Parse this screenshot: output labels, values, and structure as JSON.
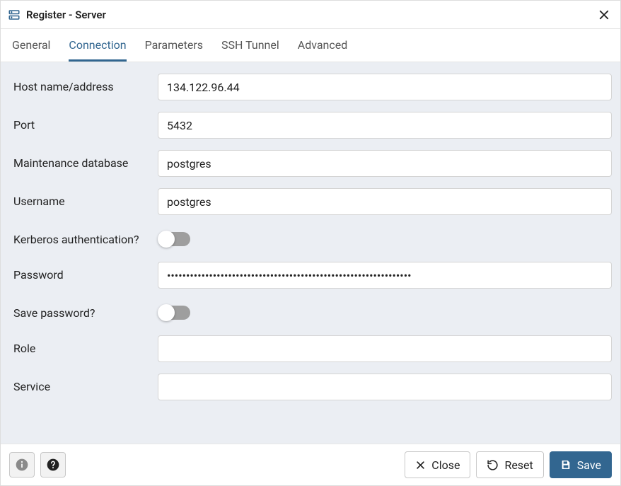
{
  "window": {
    "title": "Register - Server"
  },
  "tabs": {
    "general": "General",
    "connection": "Connection",
    "parameters": "Parameters",
    "ssh_tunnel": "SSH Tunnel",
    "advanced": "Advanced",
    "active": "connection"
  },
  "form": {
    "host": {
      "label": "Host name/address",
      "value": "134.122.96.44"
    },
    "port": {
      "label": "Port",
      "value": "5432"
    },
    "maintenance_db": {
      "label": "Maintenance database",
      "value": "postgres"
    },
    "username": {
      "label": "Username",
      "value": "postgres"
    },
    "kerberos": {
      "label": "Kerberos authentication?",
      "value": false
    },
    "password": {
      "label": "Password",
      "value": "••••••••••••••••••••••••••••••••••••••••••••••••••••••••••••••••"
    },
    "save_password": {
      "label": "Save password?",
      "value": false
    },
    "role": {
      "label": "Role",
      "value": ""
    },
    "service": {
      "label": "Service",
      "value": ""
    }
  },
  "footer": {
    "close": "Close",
    "reset": "Reset",
    "save": "Save"
  }
}
